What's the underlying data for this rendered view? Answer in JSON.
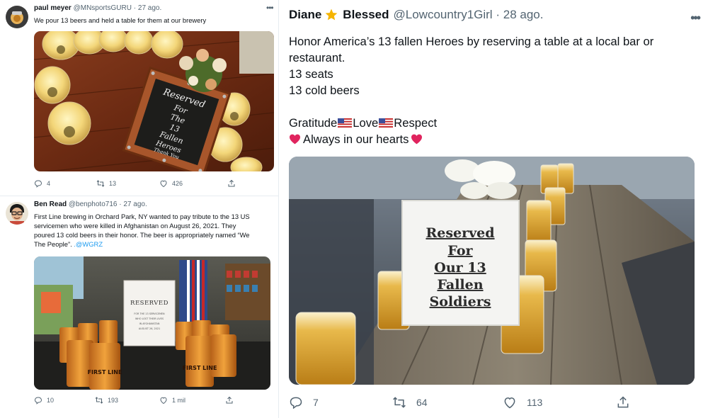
{
  "tweet1": {
    "name": "paul meyer",
    "handle": "@MNsportsGURU",
    "dot": "·",
    "date": "27 ago.",
    "text": "We pour 13 beers and held a table for them at our brewery",
    "sign": {
      "lines": [
        "Reserved",
        "For",
        "The",
        "13",
        "Fallen",
        "Heroes",
        "Thank You"
      ]
    },
    "actions": {
      "replies": "4",
      "retweets": "13",
      "likes": "426"
    }
  },
  "tweet2": {
    "name": "Ben Read",
    "handle": "@benphoto716",
    "dot": "·",
    "date": "27 ago.",
    "text_lines": [
      "First Line brewing in Orchard Park, NY wanted to pay tribute to the 13 US",
      "servicemen who were killed in Afghanistan on August 26, 2021. They",
      "poured 13 cold beers in their honor. The beer is appropriately named “We",
      "The People”."
    ],
    "mention": ".@WGRZ",
    "sign": {
      "title": "RESERVED",
      "lines": [
        "FOR THE 13 SERVICEMEN",
        "WHO LOST THEIR LIVES",
        "IN AFGHANISTAN",
        "AUGUST 26, 2021"
      ]
    },
    "can_label": "FIRST LINE",
    "actions": {
      "replies": "10",
      "retweets": "193",
      "likes": "1 mil"
    }
  },
  "tweet3": {
    "name_part1": "Diane",
    "name_part2": "Blessed",
    "handle": "@Lowcountry1Girl",
    "dot": "·",
    "date": "28 ago.",
    "lines": [
      "Honor America’s 13 fallen Heroes by reserving a table at a local bar or",
      "restaurant.",
      "13 seats",
      "13 cold beers"
    ],
    "gratitude": [
      "Gratitude",
      "Love",
      "Respect"
    ],
    "hearts_line": "Always in our hearts",
    "sign": {
      "lines": [
        "Reserved",
        "For",
        "Our 13",
        "Fallen",
        "Soldiers"
      ]
    },
    "actions": {
      "replies": "7",
      "retweets": "64",
      "likes": "113"
    }
  },
  "colors": {
    "text": "#0f1419",
    "muted": "#536471",
    "link": "#1d9bf0",
    "heart": "#e0245e",
    "divider": "#e6ecf0"
  },
  "icons": [
    "reply-icon",
    "retweet-icon",
    "like-icon",
    "share-icon",
    "more-icon",
    "star-icon",
    "us-flag-icon",
    "red-heart-icon"
  ]
}
